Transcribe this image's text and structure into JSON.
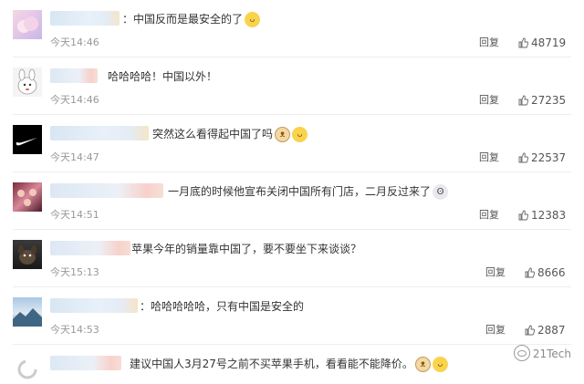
{
  "colors": {
    "text": "#333333",
    "meta": "#999999",
    "separator": "#eeeeee"
  },
  "comments": [
    {
      "text": "：中国反而是最安全的了",
      "emoji": "cat-face-icon",
      "time": "今天14:46",
      "reply": "回复",
      "likes": "48719",
      "avatar_icon": "pink-cloud-avatar"
    },
    {
      "text": "哈哈哈哈！中国以外！",
      "emoji": "",
      "time": "今天14:46",
      "reply": "回复",
      "likes": "27235",
      "avatar_icon": "cartoon-rabbit-avatar"
    },
    {
      "text": "突然这么看得起中国了吗",
      "emoji": "dog-and-cat-icons",
      "time": "今天14:47",
      "reply": "回复",
      "likes": "22537",
      "avatar_icon": "nike-swoosh-avatar"
    },
    {
      "text": "一月底的时候他宣布关闭中国所有门店，二月反过来了",
      "emoji": "scared-face-icon",
      "time": "今天14:51",
      "reply": "回复",
      "likes": "12383",
      "avatar_icon": "group-photo-avatar"
    },
    {
      "text": "苹果今年的销量靠中国了，要不要坐下来谈谈？",
      "emoji": "",
      "time": "今天15:13",
      "reply": "回复",
      "likes": "8666",
      "avatar_icon": "dog-photo-avatar"
    },
    {
      "text": "：哈哈哈哈哈，只有中国是安全的",
      "emoji": "",
      "time": "今天14:53",
      "reply": "回复",
      "likes": "2887",
      "avatar_icon": "landscape-avatar"
    },
    {
      "text": "建议中国人3月27号之前不买苹果手机，看看能不能降价。",
      "emoji": "dog-and-cat-icons",
      "time": "",
      "reply": "",
      "likes": "",
      "avatar_icon": "loading-spinner-avatar"
    }
  ],
  "watermark": "21Tech"
}
